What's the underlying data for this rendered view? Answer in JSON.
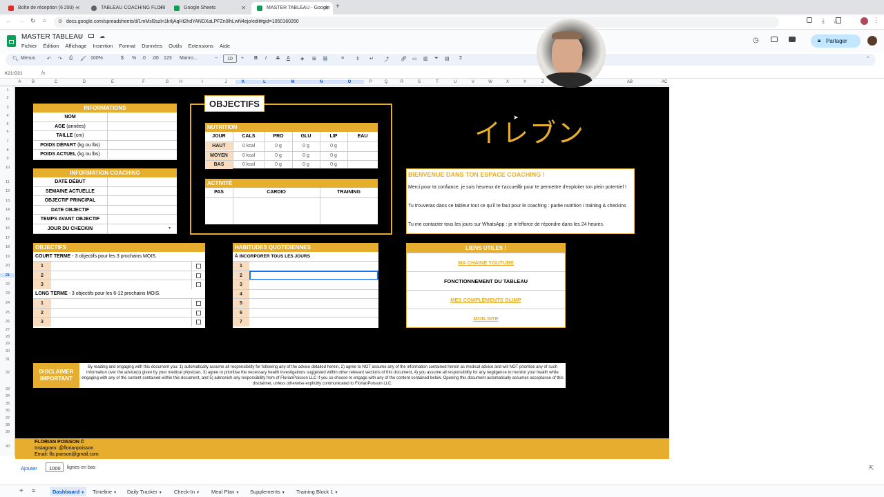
{
  "browser": {
    "tabs": [
      {
        "label": "Boîte de réception (6 293) -",
        "favicon_color": "#d93025"
      },
      {
        "label": "TABLEAU COACHING FLORI",
        "favicon_color": "#5f6368"
      },
      {
        "label": "Google Sheets",
        "favicon_color": "#0f9d58"
      },
      {
        "label": "MASTER TABLEAU - Google",
        "favicon_color": "#0f9d58"
      }
    ],
    "url": "docs.google.com/spreadsheets/d/1mMsl9szIn1krljAqHt2hdYANDXaLPFZn0lhLwN4ejo/edit#gid=1050160260"
  },
  "app": {
    "title": "MASTER TABLEAU",
    "menus": [
      "Fichier",
      "Édition",
      "Affichage",
      "Insertion",
      "Format",
      "Données",
      "Outils",
      "Extensions",
      "Aide"
    ],
    "share_label": "Partager"
  },
  "toolbar": {
    "search": "Menus",
    "zoom": "100%",
    "currency": "$",
    "percent": "%",
    "dec_less": ".0",
    "dec_more": ".00",
    "number_format": "123",
    "font": "Manro...",
    "font_size": "10",
    "bold": "B",
    "italic": "I",
    "strike": "S",
    "textcolor": "A",
    "sum": "Σ"
  },
  "formula_bar": {
    "cell_ref": "K21:O21",
    "fx": "fx"
  },
  "columns": [
    "A",
    "B",
    "C",
    "D",
    "E",
    "F",
    "G",
    "H",
    "I",
    "J",
    "K",
    "L",
    "M",
    "N",
    "O",
    "P",
    "Q",
    "R",
    "S",
    "T",
    "U",
    "V",
    "W",
    "X",
    "Y",
    "Z",
    "AA",
    "AB",
    "AC"
  ],
  "rows": [
    "1",
    "2",
    "3",
    "4",
    "5",
    "6",
    "7",
    "8",
    "9",
    "10",
    "11",
    "12",
    "13",
    "14",
    "15",
    "16",
    "17",
    "18",
    "19",
    "20",
    "21",
    "22",
    "23",
    "24",
    "25",
    "26",
    "27",
    "28",
    "29",
    "30",
    "31",
    "32",
    "33",
    "34",
    "35",
    "36",
    "37",
    "38",
    "39",
    "40"
  ],
  "informations": {
    "title": "INFORMATIONS",
    "rows": [
      {
        "label": "NOM",
        "unit": ""
      },
      {
        "label": "AGE",
        "unit": " (années)"
      },
      {
        "label": "TAILLE",
        "unit": " (cm)"
      },
      {
        "label": "POIDS DÉPART",
        "unit": " (kg ou lbs)"
      },
      {
        "label": "POIDS ACTUEL",
        "unit": " (kg ou lbs)"
      }
    ]
  },
  "coaching": {
    "title": "INFORMATION COACHING",
    "rows": [
      "DATE DÉBUT",
      "SEMAINE ACTUELLE",
      "OBJECTIF PRINCIPAL",
      "DATE OBJECTIF",
      "TEMPS AVANT OBJECTIF",
      "JOUR DU CHECKIN"
    ]
  },
  "objectifs_panel": {
    "title": "OBJECTIFS",
    "nutrition": {
      "title": "NUTRITION",
      "headers": [
        "JOUR",
        "CALS",
        "PRO",
        "GLU",
        "LIP",
        "EAU"
      ],
      "rows": [
        [
          "HAUT",
          "0 kcal",
          "0 g",
          "0 g",
          "0 g",
          ""
        ],
        [
          "MOYEN",
          "0 kcal",
          "0 g",
          "0 g",
          "0 g",
          ""
        ],
        [
          "BAS",
          "0 kcal",
          "0 g",
          "0 g",
          "0 g",
          ""
        ]
      ]
    },
    "activite": {
      "title": "ACTIVITÉ",
      "headers": [
        "PAS",
        "CARDIO",
        "TRAINING"
      ]
    }
  },
  "logo_text": "イレブン",
  "welcome": {
    "title": "BIENVENUE DANS TON ESPACE COACHING !",
    "p1": "Merci pour ta confiance, je suis heureux de t'accueillir pour te permettre d'exploiter ton plein potentiel !",
    "p2": "Tu trouveras dans ce tableur tout ce qu'il te faut pour le coaching : partie nutrition / training & checkins",
    "p3": "Tu me contacter tous les jours sur WhatsApp : je m'efforce de répondre dans les 24 heures."
  },
  "objectifs": {
    "title": "OBJECTIFS",
    "short_label": "COURT TERME",
    "short_desc": " - 3 objectifs pour les 3 prochains MOIS.",
    "long_label": "LONG TERME",
    "long_desc": " - 3 objectifs pour les 6-12 prochains MOIS.",
    "nums": [
      "1",
      "2",
      "3"
    ]
  },
  "habitudes": {
    "title": "HABITUDES QUOTIDIENNES",
    "subtitle": "À INCORPORER TOUS LES JOURS",
    "nums": [
      "1",
      "2",
      "3",
      "4",
      "5",
      "6",
      "7"
    ]
  },
  "liens": {
    "title": "LIENS UTILES !",
    "items": [
      {
        "label": "MA CHAINE YOUTUBE",
        "link": true
      },
      {
        "label": "FONCTIONNEMENT DU TABLEAU",
        "link": false
      },
      {
        "label": "MES COMPLÉMENTS OLIMP",
        "link": true
      },
      {
        "label": "MON SITE",
        "link": true
      }
    ]
  },
  "disclaimer": {
    "title": "DISCLAIMER IMPORTANT",
    "text": "By reading and engaging with this document you: 1) automatically assume all responsibility for following any of the advice detailed herein, 2) agree to NOT assume any of the information contained herein as medical advice and will NOT prioritise any of such information over the advice(s) given by your medical physician, 3) agree to prioritise the necessary health investigations suggested within other relevant sections of this document, 4) you assume all responsibility for any negligence to monitor your health while engaging with any of the content contained within this document, and 5) admonish any responsibility from of FlorianPoisson LLC if you so choose to engage with any of the content contained below. Opening this document automatically assumes acceptance of this disclaimer, unless otherwise explicitly communicated to FlorianPoisson LLC."
  },
  "footer": {
    "name": "FLORIAN POISSON ©",
    "instagram": "Instagram: @florianpoisson",
    "email": "Email: flo.poirson@gmail.com"
  },
  "add_rows": {
    "button": "Ajouter",
    "value": "1000",
    "suffix": "lignes en bas"
  },
  "sheet_tabs": [
    "Dashboard",
    "Timeline",
    "Daily Tracker",
    "Check-In",
    "Meal Plan",
    "Supplements",
    "Training Block 1"
  ],
  "colors": {
    "accent": "#e6ad2e",
    "sheet_bg": "#000000",
    "link": "#e6ad2e"
  }
}
